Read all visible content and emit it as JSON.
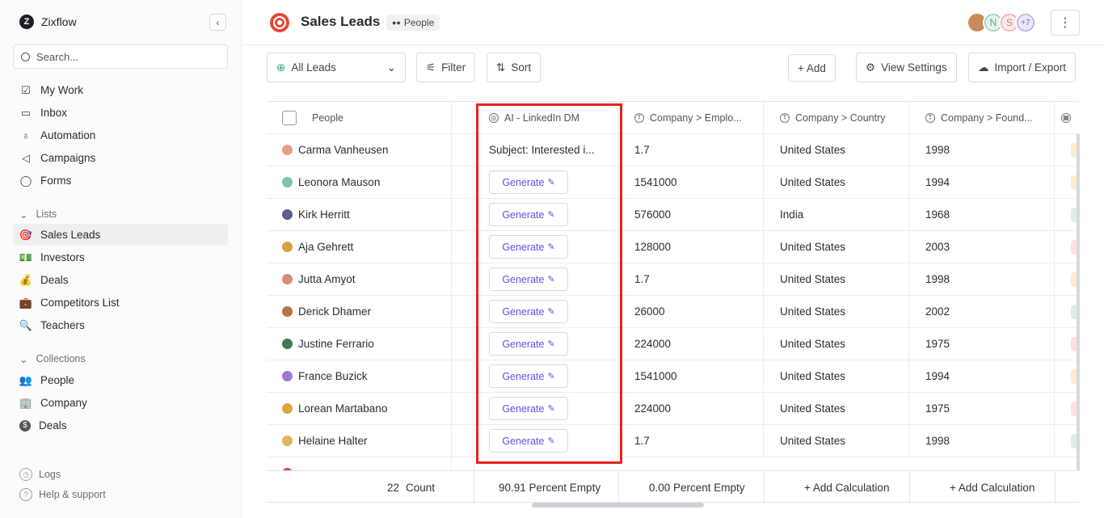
{
  "brand": {
    "name": "Zixflow",
    "logo_letter": "Z"
  },
  "search": {
    "placeholder": "Search..."
  },
  "nav": [
    {
      "label": "My Work",
      "icon": "checklist-icon"
    },
    {
      "label": "Inbox",
      "icon": "inbox-icon"
    },
    {
      "label": "Automation",
      "icon": "bulb-icon"
    },
    {
      "label": "Campaigns",
      "icon": "megaphone-icon"
    },
    {
      "label": "Forms",
      "icon": "chat-icon"
    }
  ],
  "lists": {
    "heading": "Lists",
    "items": [
      {
        "label": "Sales Leads",
        "icon": "target-icon",
        "glyph": "🎯",
        "active": true
      },
      {
        "label": "Investors",
        "icon": "money-icon",
        "glyph": "💵"
      },
      {
        "label": "Deals",
        "icon": "moneybag-icon",
        "glyph": "💰"
      },
      {
        "label": "Competitors List",
        "icon": "briefcase-icon",
        "glyph": "💼"
      },
      {
        "label": "Teachers",
        "icon": "magnifier-icon",
        "glyph": "🔍"
      }
    ]
  },
  "collections": {
    "heading": "Collections",
    "items": [
      {
        "label": "People",
        "icon": "people-icon",
        "glyph": "👥"
      },
      {
        "label": "Company",
        "icon": "building-icon",
        "glyph": "🏢"
      },
      {
        "label": "Deals",
        "icon": "dollar-icon",
        "glyph": "$"
      }
    ]
  },
  "footer_nav": {
    "logs": "Logs",
    "help": "Help & support"
  },
  "header": {
    "title": "Sales Leads",
    "badge": "People",
    "more_count": "+7",
    "avatar_letters": [
      "N",
      "S"
    ]
  },
  "toolbar": {
    "view": "All Leads",
    "filter": "Filter",
    "sort": "Sort",
    "add": "+ Add",
    "view_settings": "View Settings",
    "import_export": "Import / Export"
  },
  "columns": {
    "people": "People",
    "ai": "AI - LinkedIn DM",
    "employees": "Company > Emplo...",
    "country": "Company > Country",
    "founded": "Company > Found..."
  },
  "rows": [
    {
      "name": "Carma Vanheusen",
      "ai": "Subject: Interested i...",
      "employees": "1.7",
      "country": "United States",
      "founded": "1998",
      "avatar": "#e79f8a",
      "tag": "#fdebc9"
    },
    {
      "name": "Leonora Mauson",
      "ai": "",
      "employees": "1541000",
      "country": "United States",
      "founded": "1994",
      "avatar": "#7fc4a4",
      "tag": "#fdebc9"
    },
    {
      "name": "Kirk Herritt",
      "ai": "",
      "employees": "576000",
      "country": "India",
      "founded": "1968",
      "avatar": "#5a5f8e",
      "tag": "#dfeee4"
    },
    {
      "name": "Aja Gehrett",
      "ai": "",
      "employees": "128000",
      "country": "United States",
      "founded": "2003",
      "avatar": "#d9a13b",
      "tag": "#fde0e0"
    },
    {
      "name": "Jutta Amyot",
      "ai": "",
      "employees": "1.7",
      "country": "United States",
      "founded": "1998",
      "avatar": "#d88b7a",
      "tag": "#fdebc9"
    },
    {
      "name": "Derick Dhamer",
      "ai": "",
      "employees": "26000",
      "country": "United States",
      "founded": "2002",
      "avatar": "#b8733a",
      "tag": "#dfeee4"
    },
    {
      "name": "Justine Ferrario",
      "ai": "",
      "employees": "224000",
      "country": "United States",
      "founded": "1975",
      "avatar": "#3d7a55",
      "tag": "#fde0e0"
    },
    {
      "name": "France Buzick",
      "ai": "",
      "employees": "1541000",
      "country": "United States",
      "founded": "1994",
      "avatar": "#9a7ad1",
      "tag": "#fdebc9"
    },
    {
      "name": "Lorean Martabano",
      "ai": "",
      "employees": "224000",
      "country": "United States",
      "founded": "1975",
      "avatar": "#e0a33b",
      "tag": "#fde0e0"
    },
    {
      "name": "Helaine Halter",
      "ai": "",
      "employees": "1.7",
      "country": "United States",
      "founded": "1998",
      "avatar": "#e6b15a",
      "tag": "#dfeee4"
    }
  ],
  "generate_label": "Generate",
  "footer": {
    "count": "22",
    "count_label": "Count",
    "ai_empty": "90.91 Percent Empty",
    "employees_empty": "0.00 Percent Empty",
    "add_calc_1": "+ Add Calculation",
    "add_calc_2": "+ Add Calculation"
  },
  "colors": {
    "accent": "#6a4be0",
    "highlight": "#e8231c"
  }
}
